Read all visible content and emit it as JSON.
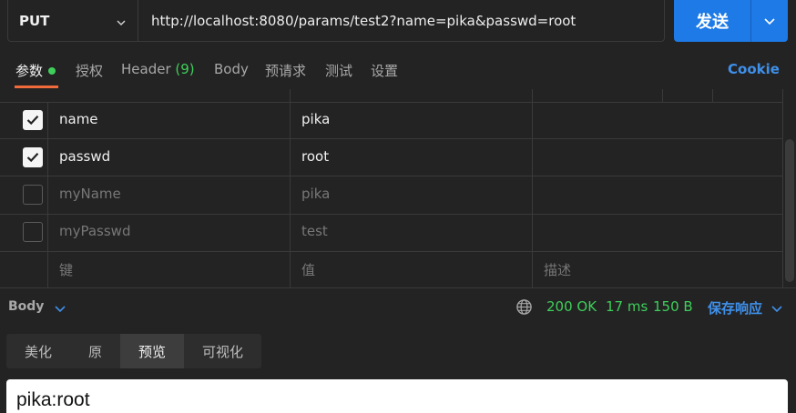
{
  "request": {
    "method": "PUT",
    "url": "http://localhost:8080/params/test2?name=pika&passwd=root",
    "send_label": "发送"
  },
  "tabs": [
    {
      "label": "参数",
      "active": true,
      "dot": true
    },
    {
      "label": "授权"
    },
    {
      "label": "Header",
      "count": "(9)"
    },
    {
      "label": "Body"
    },
    {
      "label": "预请求"
    },
    {
      "label": "测试"
    },
    {
      "label": "设置"
    }
  ],
  "cookie_label": "Cookie",
  "params": {
    "rows": [
      {
        "checked": true,
        "key": "name",
        "value": "pika"
      },
      {
        "checked": true,
        "key": "passwd",
        "value": "root"
      },
      {
        "checked": false,
        "key": "myName",
        "value": "pika"
      },
      {
        "checked": false,
        "key": "myPasswd",
        "value": "test"
      }
    ],
    "placeholder": {
      "key": "键",
      "value": "值",
      "description": "描述"
    }
  },
  "response": {
    "label": "Body",
    "status": "200 OK",
    "time": "17 ms",
    "size": "150 B",
    "save_label": "保存响应"
  },
  "view_tabs": [
    {
      "label": "美化"
    },
    {
      "label": "原"
    },
    {
      "label": "预览",
      "active": true
    },
    {
      "label": "可视化"
    }
  ],
  "preview_text": "pika:root",
  "colors": {
    "accent": "#1d7ae6",
    "success": "#3ecf5a",
    "link": "#3f90ea",
    "tab_underline": "#ef6b3c"
  }
}
